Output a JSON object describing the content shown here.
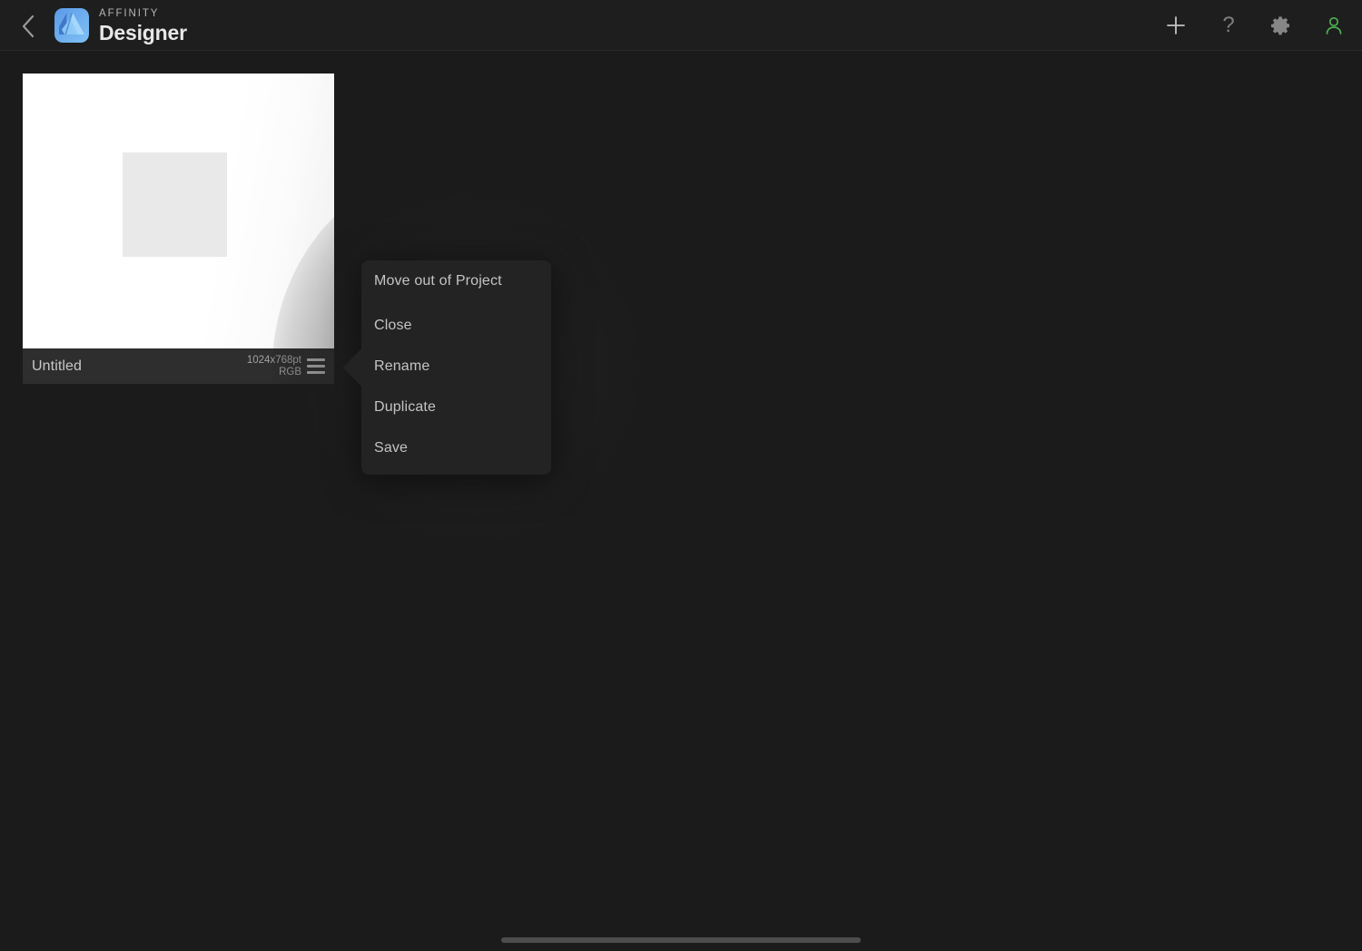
{
  "app": {
    "brand_small": "AFFINITY",
    "brand_large": "Designer",
    "logo_icon": "affinity-designer-logo",
    "background_color": "#1b1b1b",
    "header_color": "#1e1e1e"
  },
  "header": {
    "back_icon": "chevron-left-icon",
    "actions": [
      {
        "name": "new-document-button",
        "icon": "plus-icon",
        "label": "+",
        "color": "#c4c4c4"
      },
      {
        "name": "help-button",
        "icon": "question-mark-icon",
        "label": "?",
        "color": "#7e7e7e"
      },
      {
        "name": "settings-button",
        "icon": "gear-icon",
        "label": "",
        "color": "#868686"
      },
      {
        "name": "account-button",
        "icon": "person-icon",
        "label": "",
        "color": "#4caf50"
      }
    ]
  },
  "document": {
    "title": "Untitled",
    "dimensions": "1024x768pt",
    "color_space": "RGB",
    "menu_icon": "hamburger-menu-icon",
    "thumbnail_color": "#ffffff",
    "artboard_color": "#e9e9e9",
    "footer_color": "#2e2e2e"
  },
  "context_menu": {
    "visible": true,
    "background_color": "#232323",
    "items": [
      {
        "name": "menu-item-close",
        "label": "Close"
      },
      {
        "name": "menu-item-rename",
        "label": "Rename"
      },
      {
        "name": "menu-item-duplicate",
        "label": "Duplicate"
      },
      {
        "name": "menu-item-save",
        "label": "Save"
      },
      {
        "name": "menu-item-move-out-of-project",
        "label": "Move out of Project"
      }
    ]
  },
  "system": {
    "home_indicator": "home-indicator-bar"
  }
}
